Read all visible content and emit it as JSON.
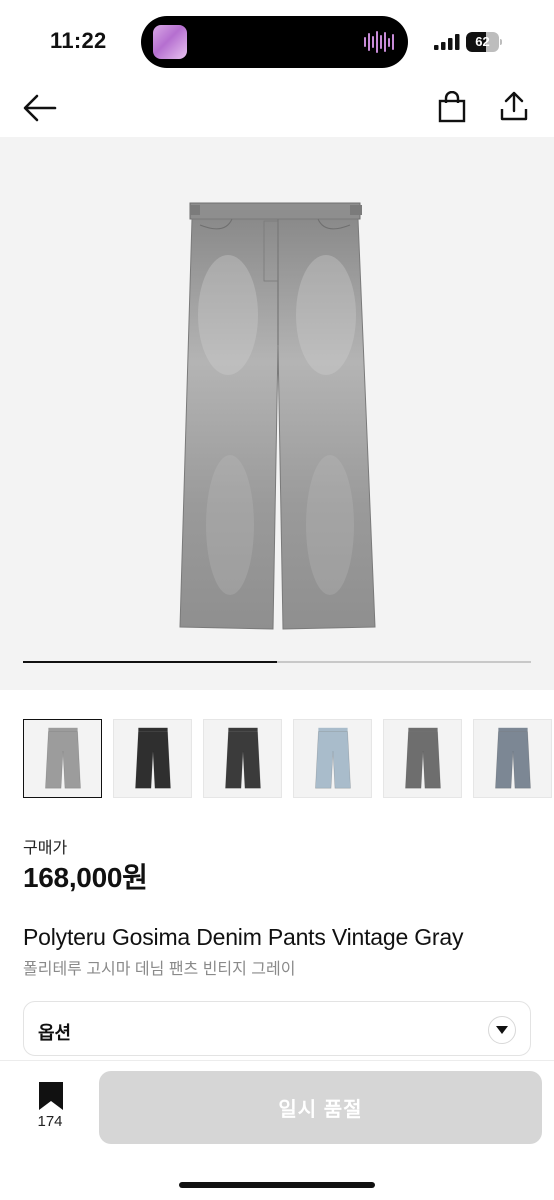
{
  "status_bar": {
    "time": "11:22",
    "battery": "62",
    "battery_level": 0.62
  },
  "product": {
    "price_label": "구매가",
    "price": "168,000원",
    "name_en": "Polyteru Gosima Denim Pants Vintage Gray",
    "name_ko": "폴리테루 고시마 데님 팬츠 빈티지 그레이"
  },
  "gallery": {
    "progress": 0.5
  },
  "thumbnails": [
    {
      "color": "#9c9c9c",
      "active": true
    },
    {
      "color": "#2f2f2f",
      "active": false
    },
    {
      "color": "#3b3b3b",
      "active": false
    },
    {
      "color": "#a9bccb",
      "active": false
    },
    {
      "color": "#6e6e6e",
      "active": false
    },
    {
      "color": "#7c8794",
      "active": false
    }
  ],
  "option": {
    "label": "옵션"
  },
  "bottom": {
    "bookmark_count": "174",
    "sold_out_label": "일시 품절"
  },
  "icons": {
    "back": "arrow-left-icon",
    "bag": "shopping-bag-icon",
    "share": "share-icon",
    "bookmark": "bookmark-icon",
    "chevron": "chevron-down-icon"
  }
}
